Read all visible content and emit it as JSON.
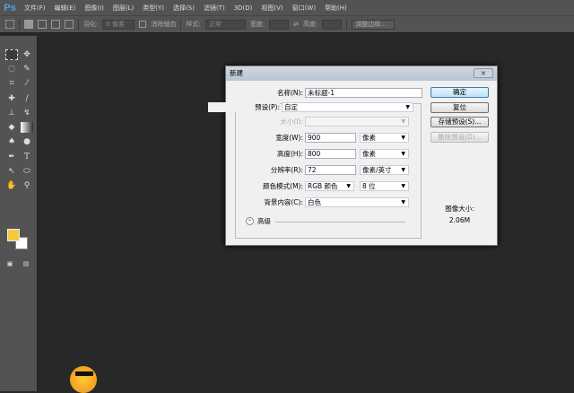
{
  "app": {
    "logo": "Ps"
  },
  "menu": [
    "文件(F)",
    "编辑(E)",
    "图像(I)",
    "图层(L)",
    "类型(Y)",
    "选择(S)",
    "滤镜(T)",
    "3D(D)",
    "视图(V)",
    "窗口(W)",
    "帮助(H)"
  ],
  "options": {
    "feather_label": "羽化:",
    "feather_value": "0 像素",
    "antialias": "消除锯齿",
    "style_label": "样式:",
    "style_value": "正常",
    "width_label": "宽度:",
    "height_label": "高度:",
    "refine": "调整边缘..."
  },
  "dialog": {
    "title": "新建",
    "close": "×",
    "name_label": "名称(N):",
    "name_value": "未标题-1",
    "preset_label": "预设(P):",
    "preset_value": "自定",
    "size_label": "大小(I):",
    "width_label": "宽度(W):",
    "width_value": "900",
    "width_unit": "像素",
    "height_label": "高度(H):",
    "height_value": "800",
    "height_unit": "像素",
    "resolution_label": "分辨率(R):",
    "resolution_value": "72",
    "resolution_unit": "像素/英寸",
    "mode_label": "颜色模式(M):",
    "mode_value": "RGB 颜色",
    "depth_value": "8 位",
    "bg_label": "背景内容(C):",
    "bg_value": "白色",
    "advanced": "高级",
    "ok": "确定",
    "reset": "复位",
    "save_preset": "存储预设(S)...",
    "delete_preset": "删除预设(D)...",
    "image_size_label": "图像大小:",
    "image_size_value": "2.06M"
  },
  "colors": {
    "foreground": "#f7c83c",
    "background": "#ffffff"
  }
}
